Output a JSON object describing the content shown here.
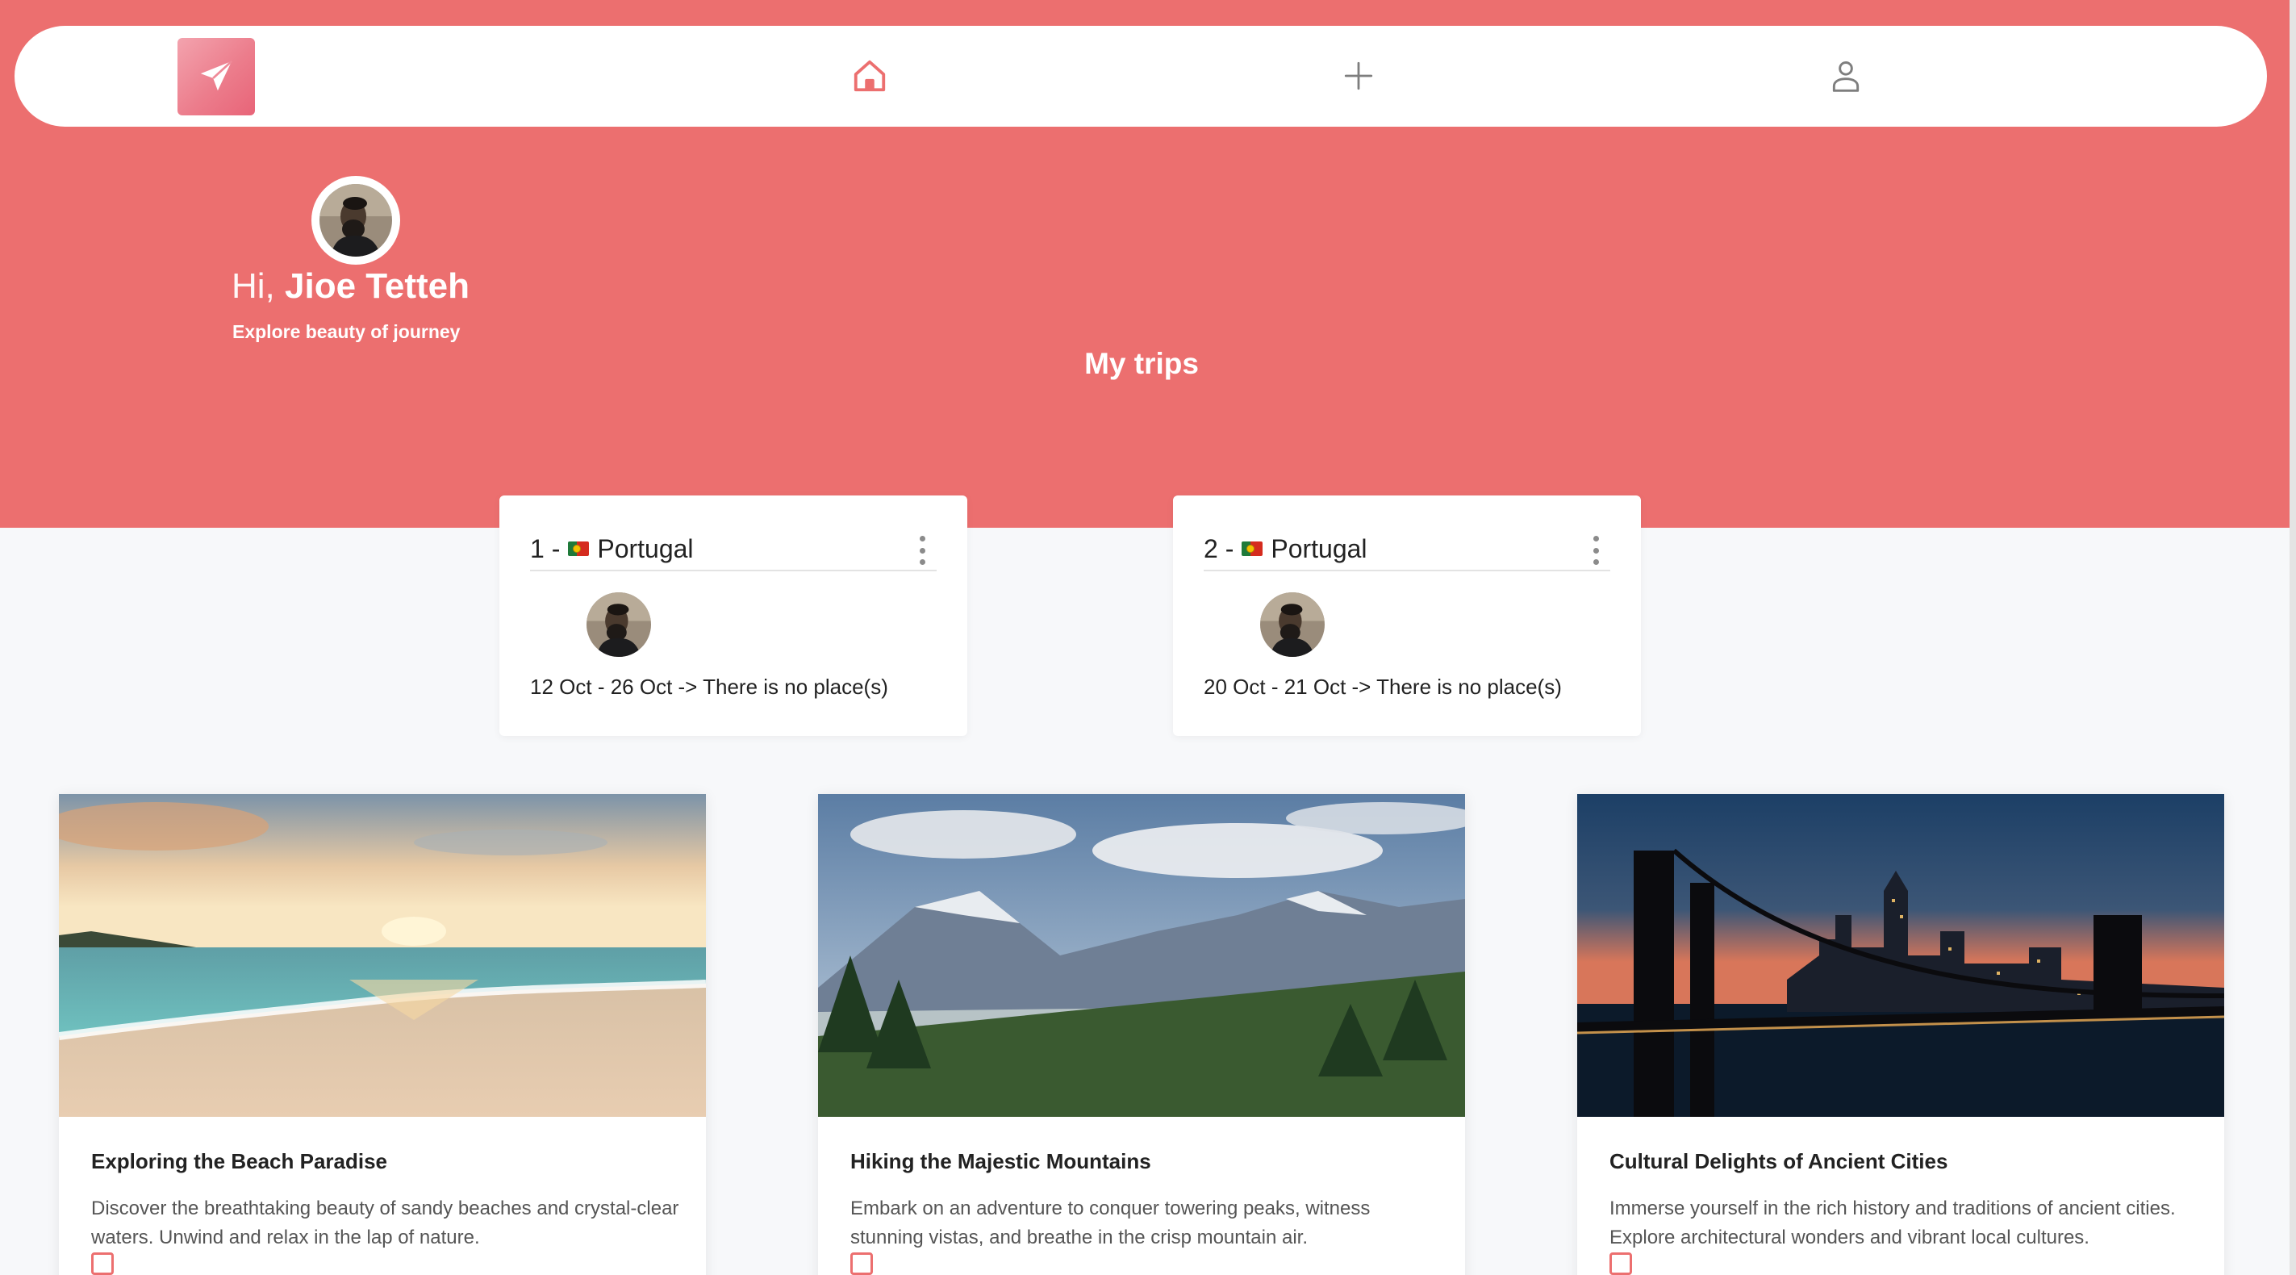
{
  "colors": {
    "brand": "#ec6f6f",
    "card_bg": "#ffffff",
    "page_bg": "#f7f8fa"
  },
  "navbar": {
    "logo_icon": "paper-plane-icon",
    "items": [
      {
        "icon": "home-icon",
        "active": true
      },
      {
        "icon": "plus-icon",
        "active": false
      },
      {
        "icon": "user-icon",
        "active": false
      }
    ]
  },
  "greeting": {
    "hi": "Hi,",
    "name": "Jioe Tetteh",
    "tagline": "Explore beauty of journey"
  },
  "section_title": "My trips",
  "trips": [
    {
      "number": "1 -",
      "country": "Portugal",
      "dates": "12 Oct - 26 Oct -> There is no place(s)"
    },
    {
      "number": "2 -",
      "country": "Portugal",
      "dates": "20 Oct - 21 Oct -> There is no place(s)"
    }
  ],
  "destinations": [
    {
      "title": "Exploring the Beach Paradise",
      "description": "Discover the breathtaking beauty of sandy beaches and crystal-clear waters. Unwind and relax in the lap of nature."
    },
    {
      "title": "Hiking the Majestic Mountains",
      "description": "Embark on an adventure to conquer towering peaks, witness stunning vistas, and breathe in the crisp mountain air."
    },
    {
      "title": "Cultural Delights of Ancient Cities",
      "description": "Immerse yourself in the rich history and traditions of ancient cities. Explore architectural wonders and vibrant local cultures."
    }
  ]
}
